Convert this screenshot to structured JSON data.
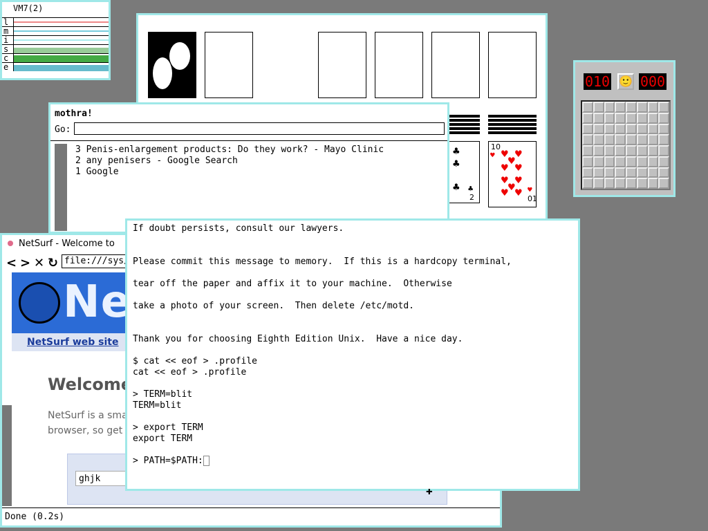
{
  "vmstat": {
    "title": "VM7(2)",
    "rows": [
      "l",
      "m",
      "i",
      "s",
      "c",
      "e"
    ]
  },
  "mothra": {
    "host": "mothra!",
    "go_label": "Go:",
    "history": [
      "3 Penis-enlargement products: Do they work? - Mayo Clinic",
      "2 any penisers - Google Search",
      "1 Google"
    ]
  },
  "netsurf": {
    "title": "NetSurf - Welcome to",
    "url": "file:///sys/",
    "logo_text": "Net",
    "nav_link": "NetSurf web site",
    "welcome": "Welcome",
    "para_lines": [
      "NetSurf is a smal",
      "browser, so get i"
    ],
    "search_value": "ghjk",
    "status": "Done (0.2s)"
  },
  "solitaire": {
    "card_clubs_rank": "2",
    "card_hearts_rank_top": "10",
    "card_hearts_rank_bottom": "01"
  },
  "minesweeper": {
    "mines_left": "010",
    "time": "000",
    "face": "🙂"
  },
  "terminal": {
    "lines": [
      "If doubt persists, consult our lawyers.",
      "",
      "",
      "Please commit this message to memory.  If this is a hardcopy terminal,",
      "",
      "tear off the paper and affix it to your machine.  Otherwise",
      "",
      "take a photo of your screen.  Then delete /etc/motd.",
      "",
      "",
      "Thank you for choosing Eighth Edition Unix.  Have a nice day.",
      "",
      "$ cat << eof > .profile",
      "cat << eof > .profile",
      "",
      "> TERM=blit",
      "TERM=blit",
      "",
      "> export TERM",
      "export TERM",
      "",
      "> PATH=$PATH:"
    ]
  },
  "colors": {
    "window_border": "#9fe8e8",
    "desktop": "#7a7a7a",
    "netsurf_blue": "#2b6bd6"
  }
}
